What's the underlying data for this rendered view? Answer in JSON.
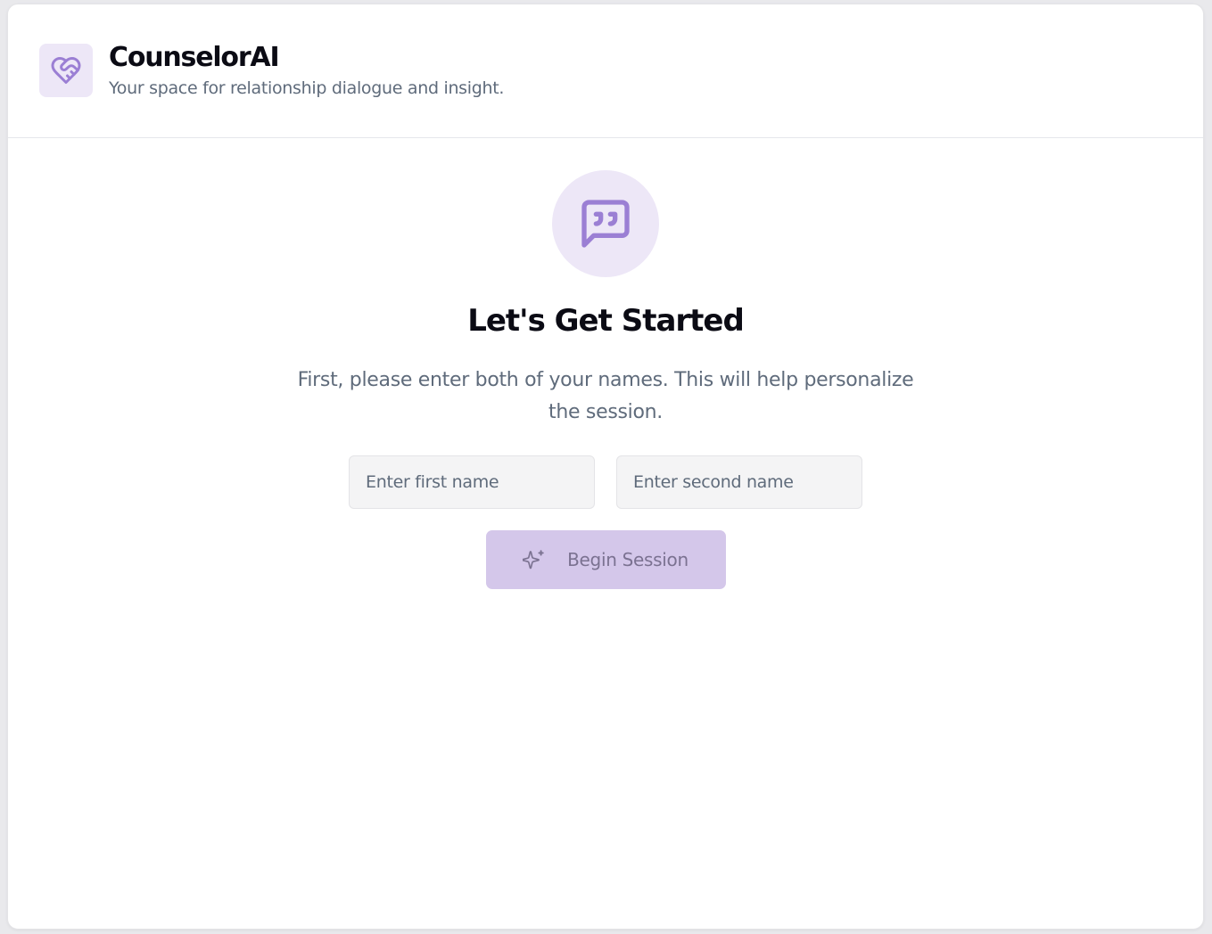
{
  "header": {
    "logo_icon": "heart-handshake-icon",
    "title": "CounselorAI",
    "subtitle": "Your space for relationship dialogue and insight."
  },
  "main": {
    "hero_icon": "message-quote-icon",
    "heading": "Let's Get Started",
    "description": "First, please enter both of your names. This will help personalize the session.",
    "first_name": {
      "value": "",
      "placeholder": "Enter first name"
    },
    "second_name": {
      "value": "",
      "placeholder": "Enter second name"
    },
    "begin_button": {
      "label": "Begin Session",
      "icon": "sparkles-icon",
      "state": "disabled"
    }
  },
  "colors": {
    "accent": "#9b7fd4",
    "accent_soft": "#ede7f7",
    "button_disabled": "#d4c7ea",
    "text_primary": "#0b0b14",
    "text_muted": "#5f6b7b"
  }
}
